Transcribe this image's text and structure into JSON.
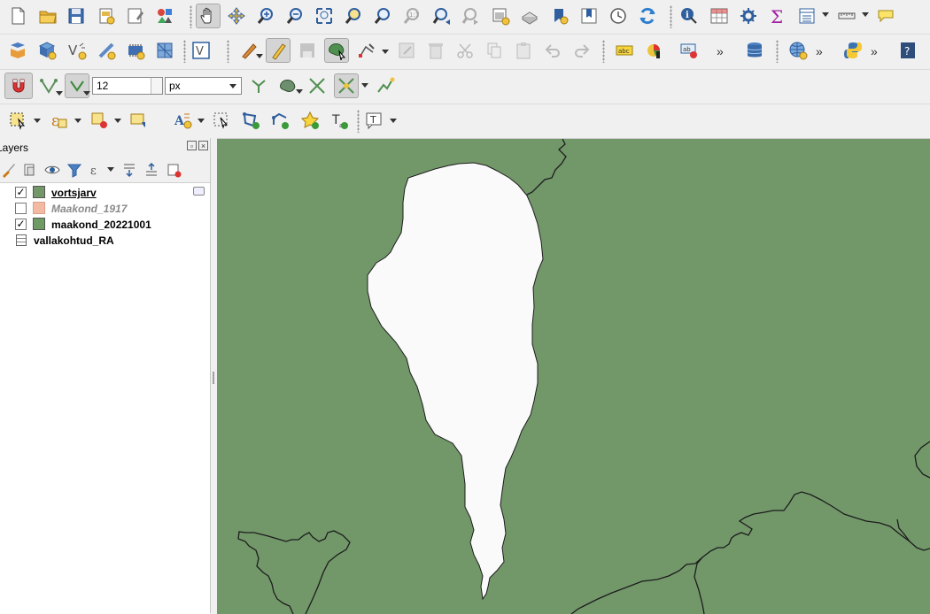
{
  "toolbars": {
    "project": [
      "new-project-icon",
      "open-project-icon",
      "save-project-icon",
      "new-print-layout-icon",
      "layout-manager-icon",
      "style-manager-icon"
    ],
    "navigation": [
      "pan-icon",
      "pan-to-selection-icon",
      "zoom-in-icon",
      "zoom-out-icon",
      "zoom-full-icon",
      "zoom-to-selection-icon",
      "zoom-to-layer-icon",
      "zoom-native-icon",
      "zoom-last-icon",
      "zoom-next-icon",
      "new-map-view-icon",
      "new-3d-view-icon",
      "spatial-bookmark-icon",
      "show-bookmarks-icon",
      "temporal-controller-icon",
      "refresh-icon"
    ],
    "attributes": [
      "identify-icon",
      "open-attribute-table-icon",
      "toolbox-icon",
      "statistics-icon",
      "open-table-icon",
      "measure-icon",
      "map-tips-icon"
    ]
  },
  "snapping": {
    "tolerance_value": "12",
    "units": "px"
  },
  "layers_panel": {
    "title": "Layers",
    "layers": [
      {
        "name": "vortsjarv",
        "checked": true,
        "color": "#72986a"
      },
      {
        "name": "Maakond_1917",
        "checked": false,
        "color": "#f3b9a3"
      },
      {
        "name": "maakond_20221001",
        "checked": true,
        "color": "#6e9a63"
      },
      {
        "name": "vallakohtud_RA",
        "checked": null,
        "color": ""
      }
    ]
  },
  "map_canvas": {
    "land_color": "#72986a",
    "lake_color": "#fafafa",
    "border_color": "#1c1c1c"
  }
}
